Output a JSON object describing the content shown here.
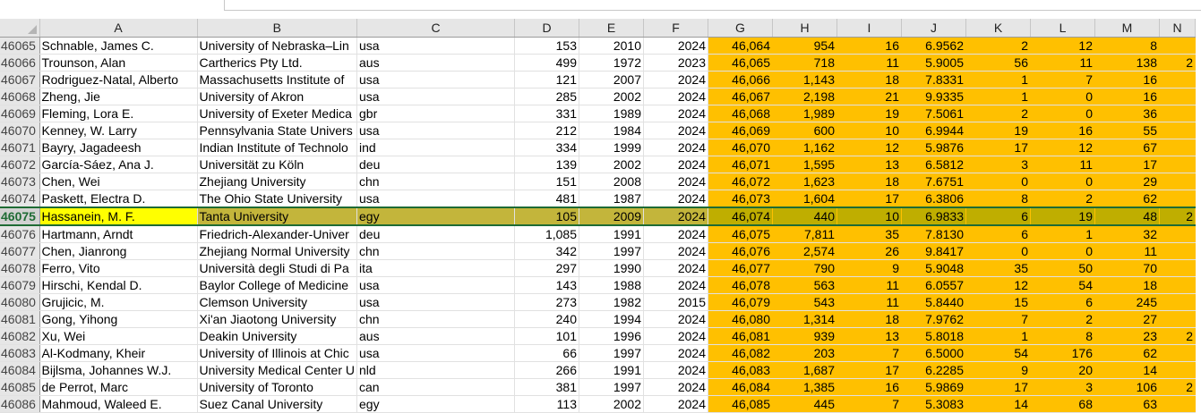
{
  "columns": [
    "A",
    "B",
    "C",
    "D",
    "E",
    "F",
    "G",
    "H",
    "I",
    "J",
    "K",
    "L",
    "M",
    "N"
  ],
  "selected_row": "46075",
  "rows": [
    {
      "rn": "46065",
      "a": "Schnable, James C.",
      "b": "University of Nebraska–Lin",
      "c": "usa",
      "d": "153",
      "e": "2010",
      "f": "2024",
      "g": "46,064",
      "h": "954",
      "i": "16",
      "j": "6.9562",
      "k": "2",
      "l": "12",
      "m": "8",
      "n": ""
    },
    {
      "rn": "46066",
      "a": "Trounson, Alan",
      "b": "Cartherics Pty Ltd.",
      "c": "aus",
      "d": "499",
      "e": "1972",
      "f": "2023",
      "g": "46,065",
      "h": "718",
      "i": "11",
      "j": "5.9005",
      "k": "56",
      "l": "11",
      "m": "138",
      "n": "2"
    },
    {
      "rn": "46067",
      "a": "Rodriguez-Natal, Alberto",
      "b": "Massachusetts Institute of",
      "c": "usa",
      "d": "121",
      "e": "2007",
      "f": "2024",
      "g": "46,066",
      "h": "1,143",
      "i": "18",
      "j": "7.8331",
      "k": "1",
      "l": "7",
      "m": "16",
      "n": ""
    },
    {
      "rn": "46068",
      "a": "Zheng, Jie",
      "b": "University of Akron",
      "c": "usa",
      "d": "285",
      "e": "2002",
      "f": "2024",
      "g": "46,067",
      "h": "2,198",
      "i": "21",
      "j": "9.9335",
      "k": "1",
      "l": "0",
      "m": "16",
      "n": ""
    },
    {
      "rn": "46069",
      "a": "Fleming, Lora E.",
      "b": "University of Exeter Medica",
      "c": "gbr",
      "d": "331",
      "e": "1989",
      "f": "2024",
      "g": "46,068",
      "h": "1,989",
      "i": "19",
      "j": "7.5061",
      "k": "2",
      "l": "0",
      "m": "36",
      "n": ""
    },
    {
      "rn": "46070",
      "a": "Kenney, W. Larry",
      "b": "Pennsylvania State Univers",
      "c": "usa",
      "d": "212",
      "e": "1984",
      "f": "2024",
      "g": "46,069",
      "h": "600",
      "i": "10",
      "j": "6.9944",
      "k": "19",
      "l": "16",
      "m": "55",
      "n": ""
    },
    {
      "rn": "46071",
      "a": "Bayry, Jagadeesh",
      "b": "Indian Institute of Technolo",
      "c": "ind",
      "d": "334",
      "e": "1999",
      "f": "2024",
      "g": "46,070",
      "h": "1,162",
      "i": "12",
      "j": "5.9876",
      "k": "17",
      "l": "12",
      "m": "67",
      "n": ""
    },
    {
      "rn": "46072",
      "a": "García-Sáez, Ana J.",
      "b": "Universität zu Köln",
      "c": "deu",
      "d": "139",
      "e": "2002",
      "f": "2024",
      "g": "46,071",
      "h": "1,595",
      "i": "13",
      "j": "6.5812",
      "k": "3",
      "l": "11",
      "m": "17",
      "n": ""
    },
    {
      "rn": "46073",
      "a": "Chen, Wei",
      "b": "Zhejiang University",
      "c": "chn",
      "d": "151",
      "e": "2008",
      "f": "2024",
      "g": "46,072",
      "h": "1,623",
      "i": "18",
      "j": "7.6751",
      "k": "0",
      "l": "0",
      "m": "29",
      "n": ""
    },
    {
      "rn": "46074",
      "a": "Paskett, Electra D.",
      "b": "The Ohio State University",
      "c": "usa",
      "d": "481",
      "e": "1987",
      "f": "2024",
      "g": "46,073",
      "h": "1,604",
      "i": "17",
      "j": "6.3806",
      "k": "8",
      "l": "2",
      "m": "62",
      "n": ""
    },
    {
      "rn": "46075",
      "a": "Hassanein, M. F.",
      "b": "Tanta University",
      "c": "egy",
      "d": "105",
      "e": "2009",
      "f": "2024",
      "g": "46,074",
      "h": "440",
      "i": "10",
      "j": "6.9833",
      "k": "6",
      "l": "19",
      "m": "48",
      "n": "2"
    },
    {
      "rn": "46076",
      "a": "Hartmann, Arndt",
      "b": "Friedrich-Alexander-Univer",
      "c": "deu",
      "d": "1,085",
      "e": "1991",
      "f": "2024",
      "g": "46,075",
      "h": "7,811",
      "i": "35",
      "j": "7.8130",
      "k": "6",
      "l": "1",
      "m": "32",
      "n": ""
    },
    {
      "rn": "46077",
      "a": "Chen, Jianrong",
      "b": "Zhejiang Normal University",
      "c": "chn",
      "d": "342",
      "e": "1997",
      "f": "2024",
      "g": "46,076",
      "h": "2,574",
      "i": "26",
      "j": "9.8417",
      "k": "0",
      "l": "0",
      "m": "11",
      "n": ""
    },
    {
      "rn": "46078",
      "a": "Ferro, Vito",
      "b": "Università degli Studi di Pa",
      "c": "ita",
      "d": "297",
      "e": "1990",
      "f": "2024",
      "g": "46,077",
      "h": "790",
      "i": "9",
      "j": "5.9048",
      "k": "35",
      "l": "50",
      "m": "70",
      "n": ""
    },
    {
      "rn": "46079",
      "a": "Hirschi, Kendal D.",
      "b": "Baylor College of Medicine",
      "c": "usa",
      "d": "143",
      "e": "1988",
      "f": "2024",
      "g": "46,078",
      "h": "563",
      "i": "11",
      "j": "6.0557",
      "k": "12",
      "l": "54",
      "m": "18",
      "n": ""
    },
    {
      "rn": "46080",
      "a": "Grujicic, M.",
      "b": "Clemson University",
      "c": "usa",
      "d": "273",
      "e": "1982",
      "f": "2015",
      "g": "46,079",
      "h": "543",
      "i": "11",
      "j": "5.8440",
      "k": "15",
      "l": "6",
      "m": "245",
      "n": ""
    },
    {
      "rn": "46081",
      "a": "Gong, Yihong",
      "b": "Xi'an Jiaotong University",
      "c": "chn",
      "d": "240",
      "e": "1994",
      "f": "2024",
      "g": "46,080",
      "h": "1,314",
      "i": "18",
      "j": "7.9762",
      "k": "7",
      "l": "2",
      "m": "27",
      "n": ""
    },
    {
      "rn": "46082",
      "a": "Xu, Wei",
      "b": "Deakin University",
      "c": "aus",
      "d": "101",
      "e": "1996",
      "f": "2024",
      "g": "46,081",
      "h": "939",
      "i": "13",
      "j": "5.8018",
      "k": "1",
      "l": "8",
      "m": "23",
      "n": "2"
    },
    {
      "rn": "46083",
      "a": "Al-Kodmany, Kheir",
      "b": "University of Illinois at Chic",
      "c": "usa",
      "d": "66",
      "e": "1997",
      "f": "2024",
      "g": "46,082",
      "h": "203",
      "i": "7",
      "j": "6.5000",
      "k": "54",
      "l": "176",
      "m": "62",
      "n": ""
    },
    {
      "rn": "46084",
      "a": "Bijlsma, Johannes W.J.",
      "b": "University Medical Center U",
      "c": "nld",
      "d": "266",
      "e": "1991",
      "f": "2024",
      "g": "46,083",
      "h": "1,687",
      "i": "17",
      "j": "6.2285",
      "k": "9",
      "l": "20",
      "m": "14",
      "n": ""
    },
    {
      "rn": "46085",
      "a": "de Perrot, Marc",
      "b": "University of Toronto",
      "c": "can",
      "d": "381",
      "e": "1997",
      "f": "2024",
      "g": "46,084",
      "h": "1,385",
      "i": "16",
      "j": "5.9869",
      "k": "17",
      "l": "3",
      "m": "106",
      "n": "2"
    },
    {
      "rn": "46086",
      "a": "Mahmoud, Waleed E.",
      "b": "Suez Canal University",
      "c": "egy",
      "d": "113",
      "e": "2002",
      "f": "2024",
      "g": "46,085",
      "h": "445",
      "i": "7",
      "j": "5.3083",
      "k": "14",
      "l": "68",
      "m": "63",
      "n": ""
    }
  ]
}
